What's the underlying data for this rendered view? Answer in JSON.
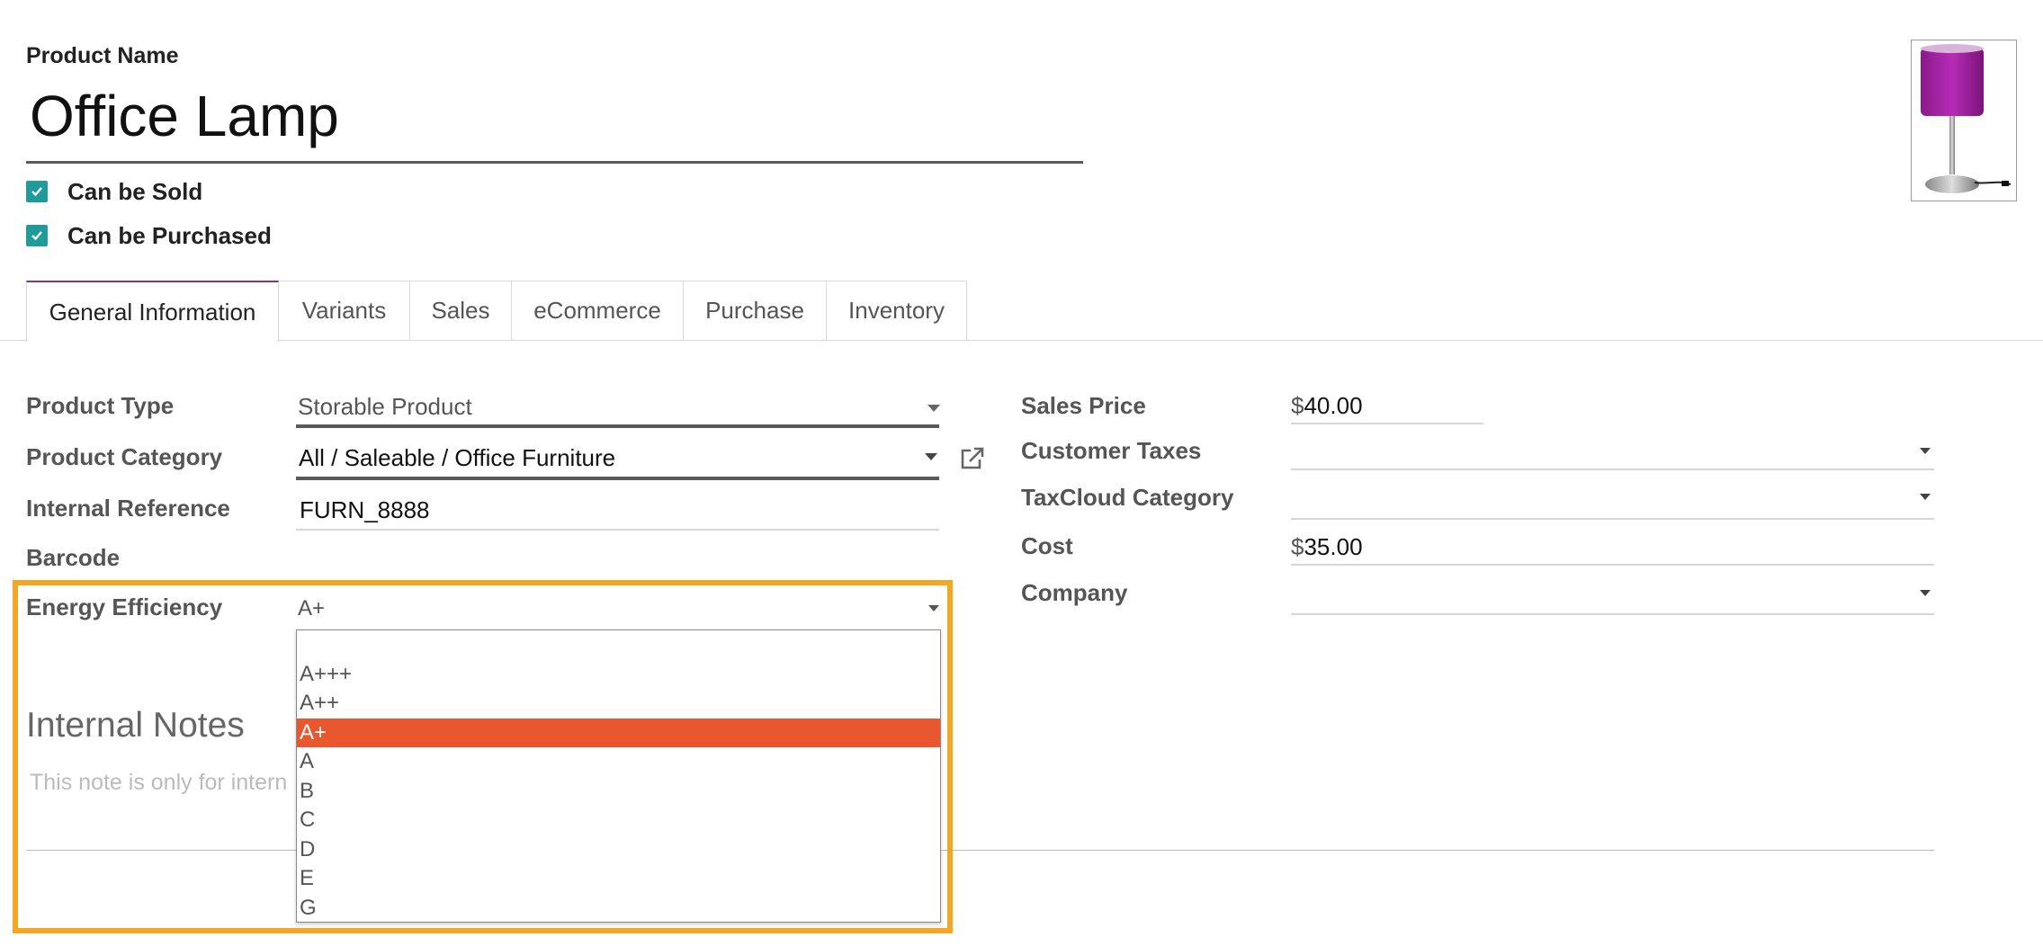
{
  "header": {
    "product_name_label": "Product Name",
    "product_name": "Office Lamp",
    "can_be_sold": "Can be Sold",
    "can_be_purchased": "Can be Purchased"
  },
  "tabs": [
    {
      "label": "General Information"
    },
    {
      "label": "Variants"
    },
    {
      "label": "Sales"
    },
    {
      "label": "eCommerce"
    },
    {
      "label": "Purchase"
    },
    {
      "label": "Inventory"
    }
  ],
  "left_fields": {
    "product_type_label": "Product Type",
    "product_type_value": "Storable Product",
    "product_category_label": "Product Category",
    "product_category_value": "All / Saleable / Office Furniture",
    "internal_reference_label": "Internal Reference",
    "internal_reference_value": "FURN_8888",
    "barcode_label": "Barcode",
    "energy_efficiency_label": "Energy Efficiency",
    "energy_efficiency_value": "A+"
  },
  "right_fields": {
    "sales_price_label": "Sales Price",
    "currency_symbol": "$",
    "sales_price_value": "40.00",
    "customer_taxes_label": "Customer Taxes",
    "taxcloud_category_label": "TaxCloud Category",
    "cost_label": "Cost",
    "cost_value": "35.00",
    "company_label": "Company"
  },
  "notes": {
    "title": "Internal Notes",
    "placeholder": "This note is only for intern"
  },
  "dropdown": {
    "options": [
      "",
      "A+++",
      "A++",
      "A+",
      "A",
      "B",
      "C",
      "D",
      "E",
      "G"
    ],
    "selected": "A+"
  },
  "colors": {
    "accent_checkbox": "#1f9b9b",
    "highlight_border": "#f5a623",
    "selected_option": "#e8572d",
    "active_tab": "#7c3b75"
  },
  "icons": {
    "checkbox": "check-icon",
    "external_link": "external-link-icon",
    "dropdown": "chevron-down-icon"
  }
}
